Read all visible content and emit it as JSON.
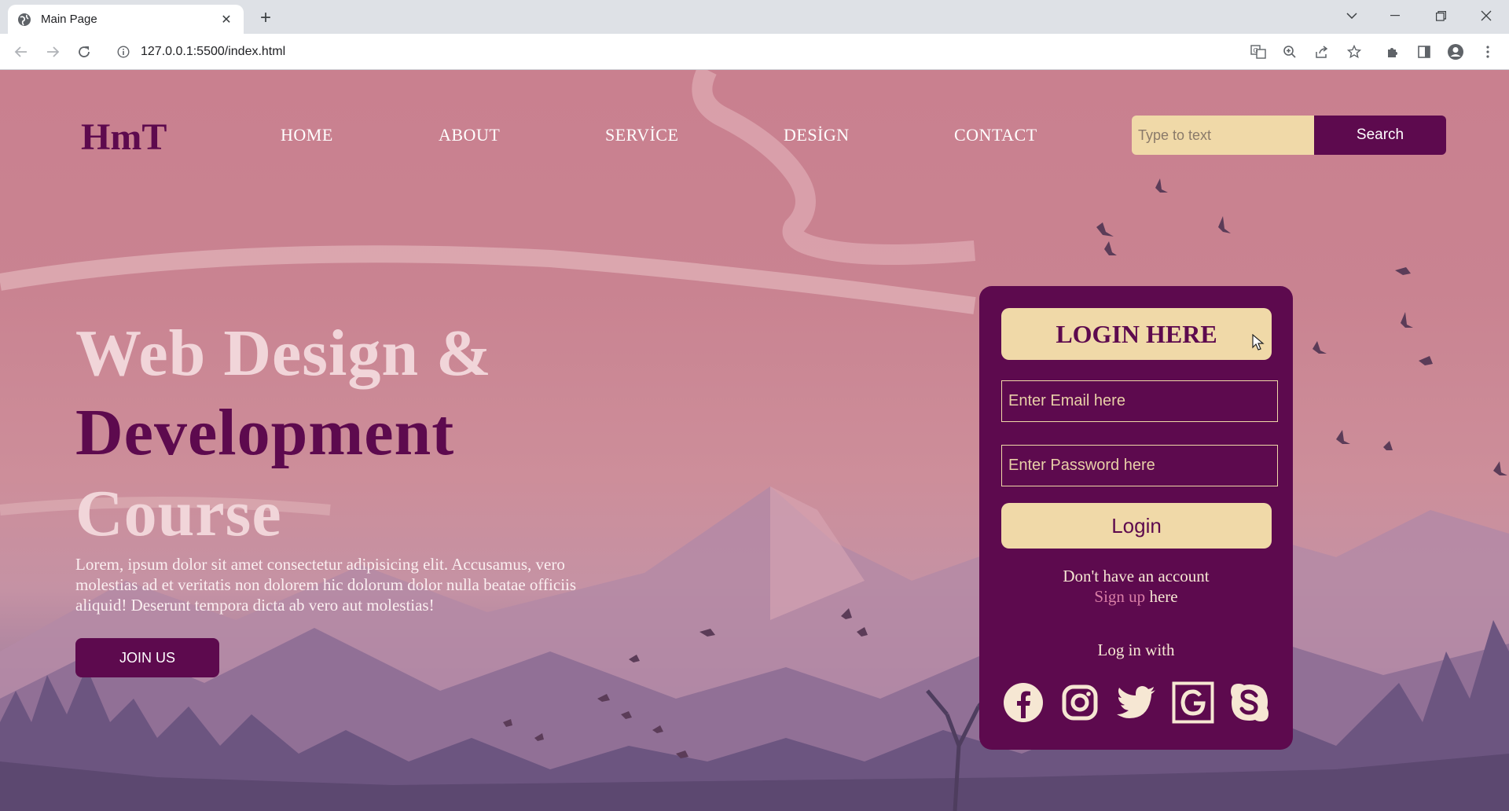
{
  "browser": {
    "tab_title": "Main Page",
    "url": "127.0.0.1:5500/index.html"
  },
  "site": {
    "logo": "HmT",
    "nav": [
      "HOME",
      "ABOUT",
      "SERVİCE",
      "DESİGN",
      "CONTACT"
    ],
    "search": {
      "placeholder": "Type to text",
      "button": "Search"
    }
  },
  "hero": {
    "line1": "Web Design &",
    "line2": "Development",
    "line3": "Course",
    "description": "Lorem, ipsum dolor sit amet consectetur adipisicing elit. Accusamus, vero molestias ad et veritatis non dolorem hic dolorum dolor nulla beatae officiis aliquid! Deserunt tempora dicta ab vero aut molestias!",
    "join_button": "JOIN US"
  },
  "login": {
    "title": "LOGIN HERE",
    "email_placeholder": "Enter Email here",
    "password_placeholder": "Enter Password here",
    "submit": "Login",
    "no_account": "Don't have an account",
    "signup_link": "Sign up",
    "signup_suffix": " here",
    "login_with": "Log in with",
    "social_icons": [
      "facebook-icon",
      "instagram-icon",
      "twitter-icon",
      "google-icon",
      "skype-icon"
    ]
  },
  "colors": {
    "brand_purple": "#5d0a4e",
    "cream": "#f0d9a8",
    "hero_light": "#f1d5d9",
    "signup_pink": "#d97fa6"
  }
}
